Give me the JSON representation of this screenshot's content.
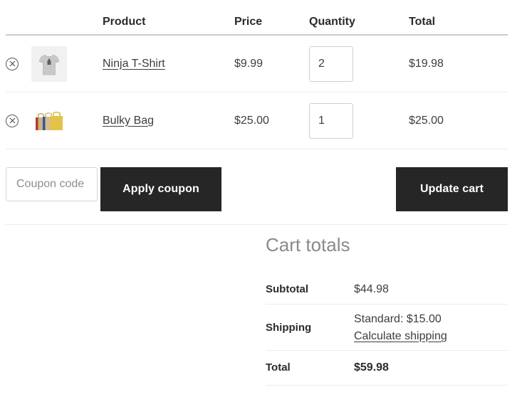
{
  "cart_table": {
    "columns": [
      "",
      "",
      "Product",
      "Price",
      "Quantity",
      "Total"
    ],
    "headers": {
      "product": "Product",
      "price": "Price",
      "quantity": "Quantity",
      "total": "Total"
    },
    "rows": [
      {
        "remove_icon": "circle-x-icon",
        "thumbnail_icon": "tshirt-thumbnail",
        "name": "Ninja T-Shirt",
        "price": "$9.99",
        "quantity": "2",
        "total": "$19.98"
      },
      {
        "remove_icon": "circle-x-icon",
        "thumbnail_icon": "shopping-bags-thumbnail",
        "name": "Bulky Bag",
        "price": "$25.00",
        "quantity": "1",
        "total": "$25.00"
      }
    ]
  },
  "actions": {
    "coupon_placeholder": "Coupon code",
    "coupon_value": "",
    "apply_coupon_label": "Apply coupon",
    "update_cart_label": "Update cart"
  },
  "cart_totals": {
    "title": "Cart totals",
    "subtotal_label": "Subtotal",
    "subtotal_value": "$44.98",
    "shipping_label": "Shipping",
    "shipping_method": "Standard: $15.00",
    "shipping_link": "Calculate shipping",
    "total_label": "Total",
    "total_value": "$59.98"
  },
  "colors": {
    "button_bg": "#262626",
    "button_text": "#ffffff",
    "text": "#3d3d3d",
    "heading_gray": "#8a8a8a",
    "divider": "#ececec",
    "header_rule": "#c9c9c9",
    "thumb_bg": "#f1f1f1"
  }
}
